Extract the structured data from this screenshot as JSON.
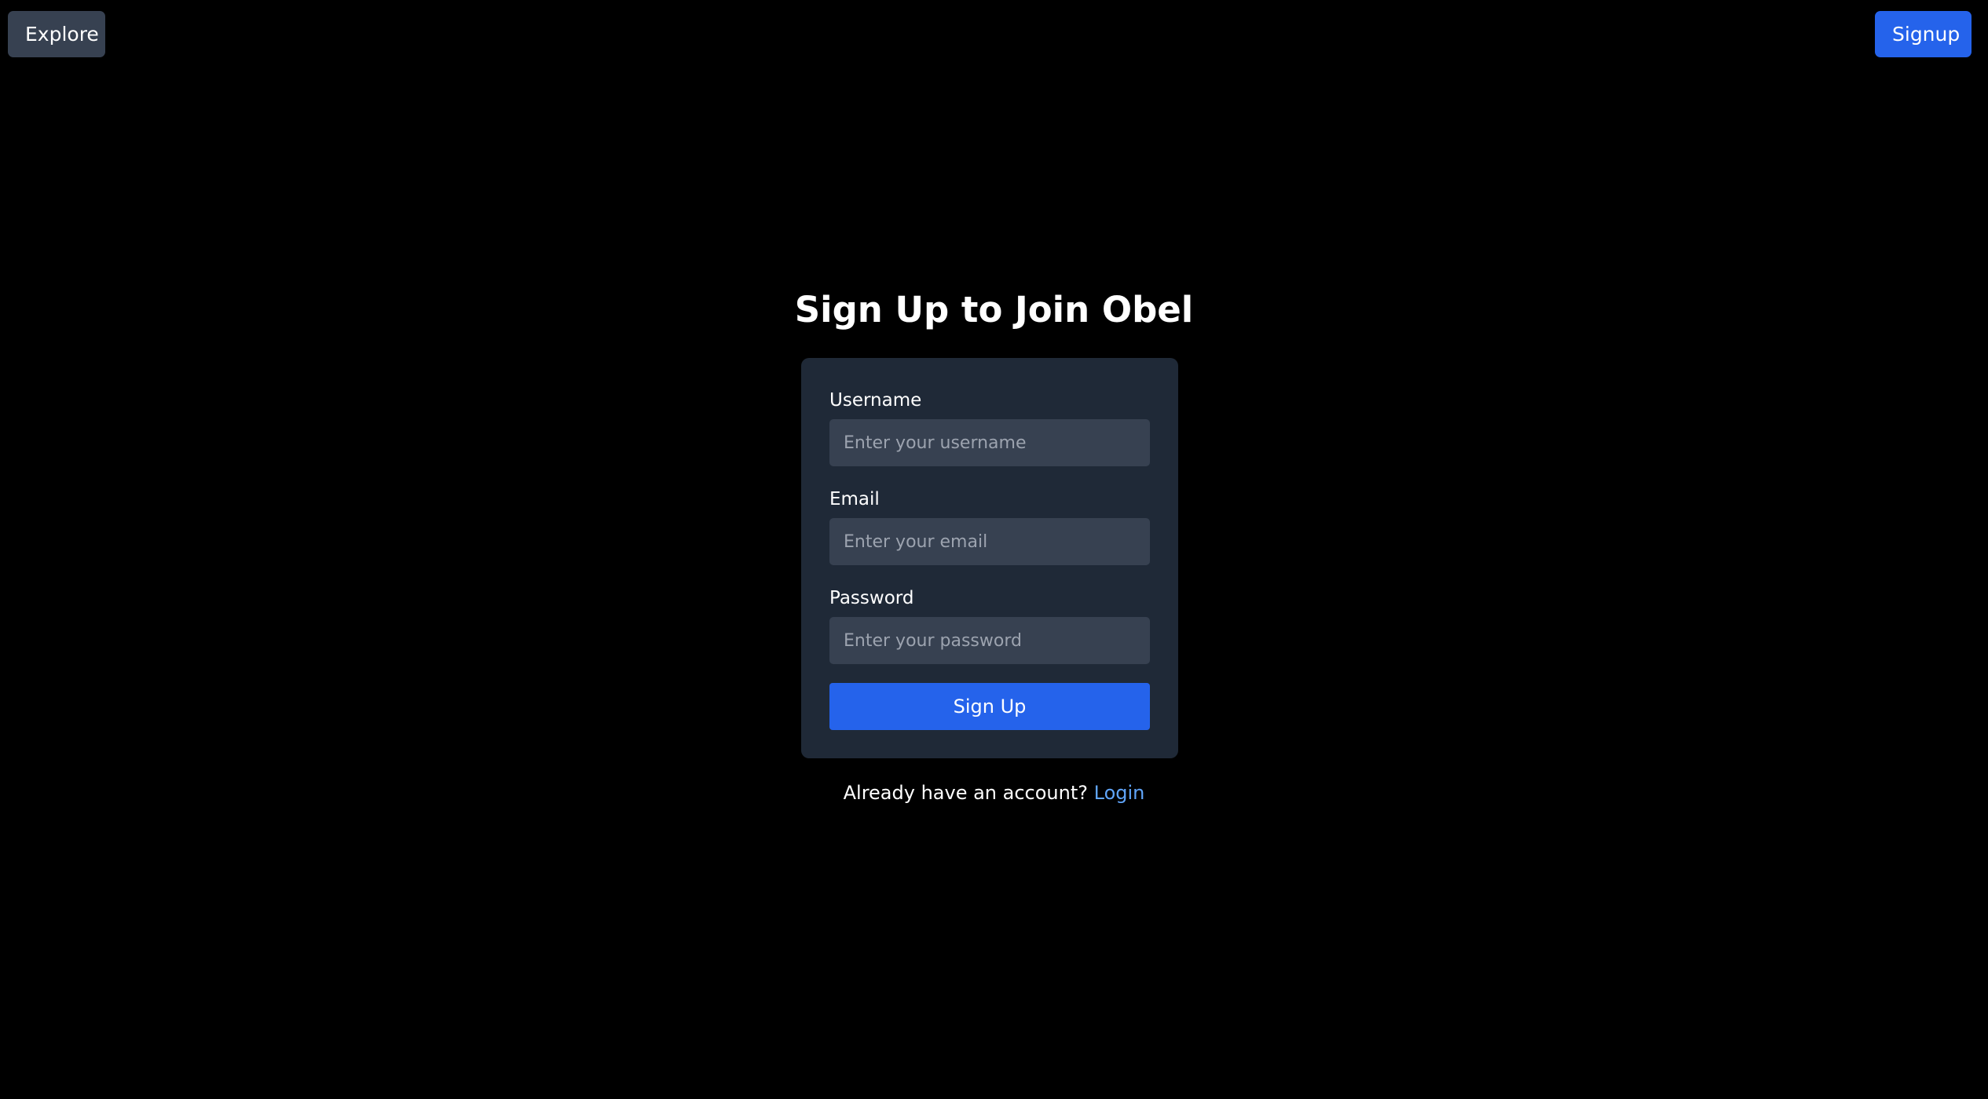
{
  "nav": {
    "explore_label": "Explore",
    "signup_label": "Signup"
  },
  "page": {
    "title": "Sign Up to Join Obel"
  },
  "form": {
    "username": {
      "label": "Username",
      "placeholder": "Enter your username",
      "value": ""
    },
    "email": {
      "label": "Email",
      "placeholder": "Enter your email",
      "value": ""
    },
    "password": {
      "label": "Password",
      "placeholder": "Enter your password",
      "value": ""
    },
    "submit_label": "Sign Up"
  },
  "footer": {
    "prompt": "Already have an account?",
    "login_link": "Login"
  },
  "colors": {
    "background": "#000000",
    "card": "#1f2937",
    "input": "#374151",
    "accent": "#2563eb",
    "link": "#60a5fa"
  }
}
